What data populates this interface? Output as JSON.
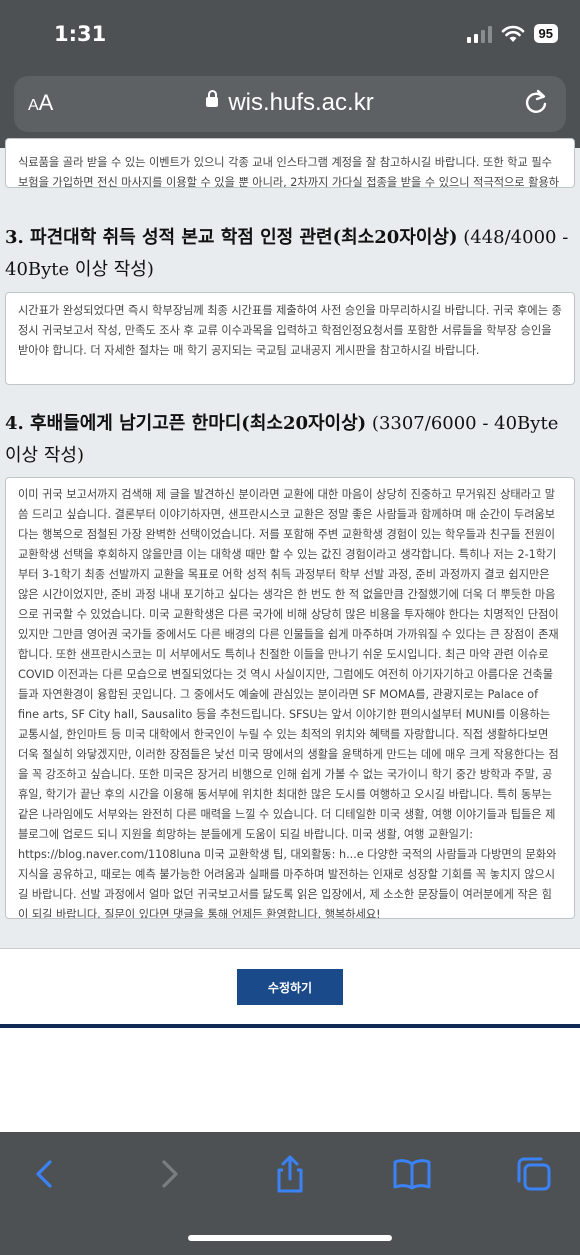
{
  "status": {
    "time": "1:31",
    "battery": "95"
  },
  "browser": {
    "aa_large": "A",
    "aa_small": "A",
    "url": "wis.hufs.ac.kr"
  },
  "form": {
    "box_top_text": "식료품을 골라 받을 수 있는 이벤트가 있으니 각종 교내 인스타그램 계정을 잘 참고하시길 바랍니다. 또한 학교 필수 보험을 가입하면 전신 마사지를 이용할 수 있을 뿐 아니라, 2차까지 가다실 접종을 받을 수 있으니 적극적으로 활용하시길 바랍니다.",
    "section3": {
      "title": "3. 파견대학 취득 성적 본교 학점 인정 관련(최소20자이상)",
      "count": " (448/4000 - 40Byte 이상 작성)",
      "text": "시간표가 완성되었다면 즉시 학부장님께 최종 시간표를 제출하여 사전 승인을 마무리하시길 바랍니다. 귀국 후에는 종정시 귀국보고서 작성, 만족도 조사 후 교류 이수과목을 입력하고 학점인정요청서를 포함한 서류들을 학부장 승인을 받아야 합니다. 더 자세한 절차는 매 학기 공지되는 국교팀 교내공지 게시판을 참고하시길 바랍니다."
    },
    "section4": {
      "title": "4. 후배들에게 남기고픈 한마디(최소20자이상)",
      "count": " (3307/6000 - 40Byte 이상 작성)",
      "text": "이미 귀국 보고서까지 검색해 제 글을 발견하신 분이라면 교환에 대한 마음이 상당히 진중하고 무거워진 상태라고 말씀 드리고 싶습니다. 결론부터 이야기하자면, 샌프란시스코 교환은 정말 좋은 사람들과 함께하며 매 순간이 두려움보다는 행복으로 점철된 가장 완벽한 선택이었습니다. 저를 포함해 주변 교환학생 경험이 있는 학우들과 친구들 전원이 교환학생 선택을 후회하지 않을만큼 이는 대학생 때만 할 수 있는 값진 경험이라고 생각합니다. 특히나 저는 2-1학기부터 3-1학기 최종 선발까지 교환을 목표로 어학 성적 취득 과정부터 학부 선발 과정, 준비 과정까지 결코 쉽지만은 않은 시간이었지만, 준비 과정 내내 포기하고 싶다는 생각은 한 번도 한 적 없을만큼 간절했기에 더욱 더 뿌듯한 마음으로 귀국할 수 있었습니다. 미국 교환학생은 다른 국가에 비해 상당히 많은 비용을 투자해야 한다는 치명적인 단점이 있지만 그만큼 영어권 국가들 중에서도 다른 배경의 다른 인물들을 쉽게 마주하며 가까워질 수 있다는 큰 장점이 존재합니다. 또한 샌프란시스코는 미 서부에서도 특히나 친절한 이들을 만나기 쉬운 도시입니다. 최근 마약 관련 이슈로 COVID 이전과는 다른 모습으로 변질되었다는 것 역시 사실이지만, 그럼에도 여전히 아기자기하고 아름다운 건축물들과 자연환경이 융합된 곳입니다. 그 중에서도 예술에 관심있는 분이라면 SF MOMA를, 관광지로는 Palace of fine arts, SF City hall, Sausalito 등을 추천드립니다. SFSU는 앞서 이야기한 편의시설부터 MUNI를 이용하는 교통시설, 한인마트 등 미국 대학에서 한국인이 누릴 수 있는 최적의 위치와 혜택를 자랑합니다. 직접 생활하다보면 더욱 절실히 와닿겠지만, 이러한 장점들은 낯선 미국 땅에서의 생활을 윤택하게 만드는 데에 매우 크게 작용한다는 점을 꼭 강조하고 싶습니다. 또한 미국은 장거리 비행으로 인해 쉽게 가볼 수 없는 국가이니 학기 중간 방학과 주말, 공휴일, 학기가 끝난 후의 시간을 이용해 동서부에 위치한 최대한 많은 도시를 여행하고 오시길 바랍니다. 특히 동부는 같은 나라임에도 서부와는 완전히 다른 매력을 느낄 수 있습니다. 더 디테일한 미국 생활, 여행 이야기들과 팁들은 제 블로그에 업로드 되니 지원을 희망하는 분들에게 도움이 되길 바랍니다. 미국 생활, 여행 교환일기: https://blog.naver.com/1108luna 미국 교환학생 팁, 대외활동: h...e 다양한 국적의 사람들과 다방면의 문화와 지식을 공유하고, 때로는 예측 불가능한 어려움과 실패를 마주하며 발전하는 인재로 성장할 기회를 꼭 놓치지 않으시길 바랍니다. 선발 과정에서 얼마 없던 귀국보고서를 닳도록 읽은 입장에서, 제 소소한 문장들이 여러분에게 작은 힘이 되길 바랍니다. 질문이 있다면 댓글을 통해 언제든 환영합니다. 행복하세요!"
    },
    "edit_button": "수정하기"
  },
  "icons": [
    "back-icon",
    "forward-icon",
    "share-icon",
    "bookmarks-icon",
    "tabs-icon",
    "reload-icon",
    "lock-icon"
  ],
  "colors": {
    "chrome": "#4d5153",
    "accent": "#1a4a8a",
    "ios_blue": "#3b82f6",
    "page_bg": "#e8ecee"
  }
}
